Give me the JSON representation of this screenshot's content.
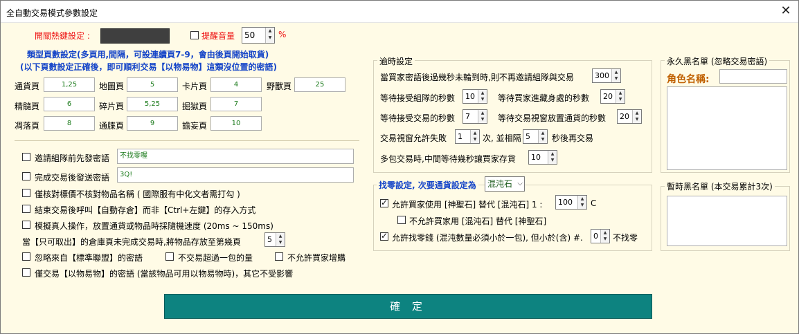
{
  "window": {
    "title": "全自動交易模式參數設定",
    "close_glyph": "✕"
  },
  "hotkey": {
    "label": "開關熱鍵設定 :"
  },
  "volume": {
    "checkbox_label": "提醒音量",
    "value": "50",
    "unit": "%"
  },
  "page_settings": {
    "title_line1": "類型頁數設定(多頁用,間隔，可設連續頁7-9，會由後頁開始取貨)",
    "title_line2": "(以下頁數設定正確後，即可順利交易【以物易物】這類沒位置的密語)",
    "rows": [
      [
        {
          "label": "通貨頁",
          "value": "1,25"
        },
        {
          "label": "地圖頁",
          "value": "5"
        },
        {
          "label": "卡片頁",
          "value": "4"
        },
        {
          "label": "野獸頁",
          "value": "25"
        }
      ],
      [
        {
          "label": "精髓頁",
          "value": "6"
        },
        {
          "label": "碎片頁",
          "value": "5,25"
        },
        {
          "label": "掘獄頁",
          "value": "7"
        }
      ],
      [
        {
          "label": "凋落頁",
          "value": "8"
        },
        {
          "label": "通牒頁",
          "value": "9"
        },
        {
          "label": "譫妄頁",
          "value": "10"
        }
      ]
    ]
  },
  "options": {
    "invite_whisper": {
      "label": "邀請組隊前先發密語",
      "value": "不找零喔"
    },
    "complete_whisper": {
      "label": "完成交易後發送密語",
      "value": "3Q!"
    },
    "price_only": "僅核對標價不核對物品名稱 ( 國際服有中化文者需打勾 )",
    "auto_store": "結束交易後呼叫【自動存倉】而非【Ctrl+左鍵】的存入方式",
    "human_sim": "模擬真人操作，放置通貨或物品時採隨機速度 (20ms ~ 150ms)",
    "move_page": {
      "label": "當【只可取出】的倉庫頁未完成交易時,將物品存放至第幾頁",
      "value": "5"
    },
    "ignore_standard": "忽略來自【標準聯盟】的密語",
    "no_over_pack": "不交易超過一包的量",
    "no_buyer_add": "不允許買家增購",
    "barter_only": "僅交易【以物易物】的密語 (當該物品可用以物易物時)，其它不受影響"
  },
  "timeout": {
    "title": "逾時設定",
    "invite_timeout": {
      "label": "當買家密語後過幾秒未輪到時,則不再邀請組隊與交易",
      "value": "300"
    },
    "accept_party": {
      "label": "等待接受組隊的秒數",
      "value": "10"
    },
    "enter_hideout": {
      "label": "等待買家進藏身處的秒數",
      "value": "20"
    },
    "accept_trade": {
      "label": "等待接受交易的秒數",
      "value": "7"
    },
    "place_currency": {
      "label": "等待交易視窗放置通貨的秒數",
      "value": "20"
    },
    "fail_prefix": "交易視窗允許失敗",
    "fail_count": "1",
    "fail_mid": "次, 並相隔",
    "fail_gap": "5",
    "fail_suffix": "秒後再交易",
    "multi_pack": {
      "label": "多包交易時,中間等待幾秒讓買家存貨",
      "value": "10"
    }
  },
  "change": {
    "title": "找零設定, 次要通貨設定為",
    "currency": "混沌石",
    "allow_sub_label": "允許買家使用 [神聖石] 替代 [混沌石]  1 :",
    "allow_sub_value": "100",
    "allow_sub_unit": "C",
    "disallow_reverse": "不允許買家用 [混沌石] 替代 [神聖石]",
    "allow_change_label": "允許找零錢 (混沌數量必須小於一包), 但小於(含) #.",
    "allow_change_value": "0",
    "allow_change_suffix": "不找零"
  },
  "blacklist": {
    "permanent_title": "永久黑名單 (忽略交易密語)",
    "role_label": "角色名稱:",
    "temp_title": "暫時黑名單 (本交易累計3次)"
  },
  "confirm_label": "確 定",
  "colors": {
    "ok": "#0d8380",
    "bg": "#fffbe6",
    "red": "#e11111",
    "blue": "#1545c8"
  }
}
